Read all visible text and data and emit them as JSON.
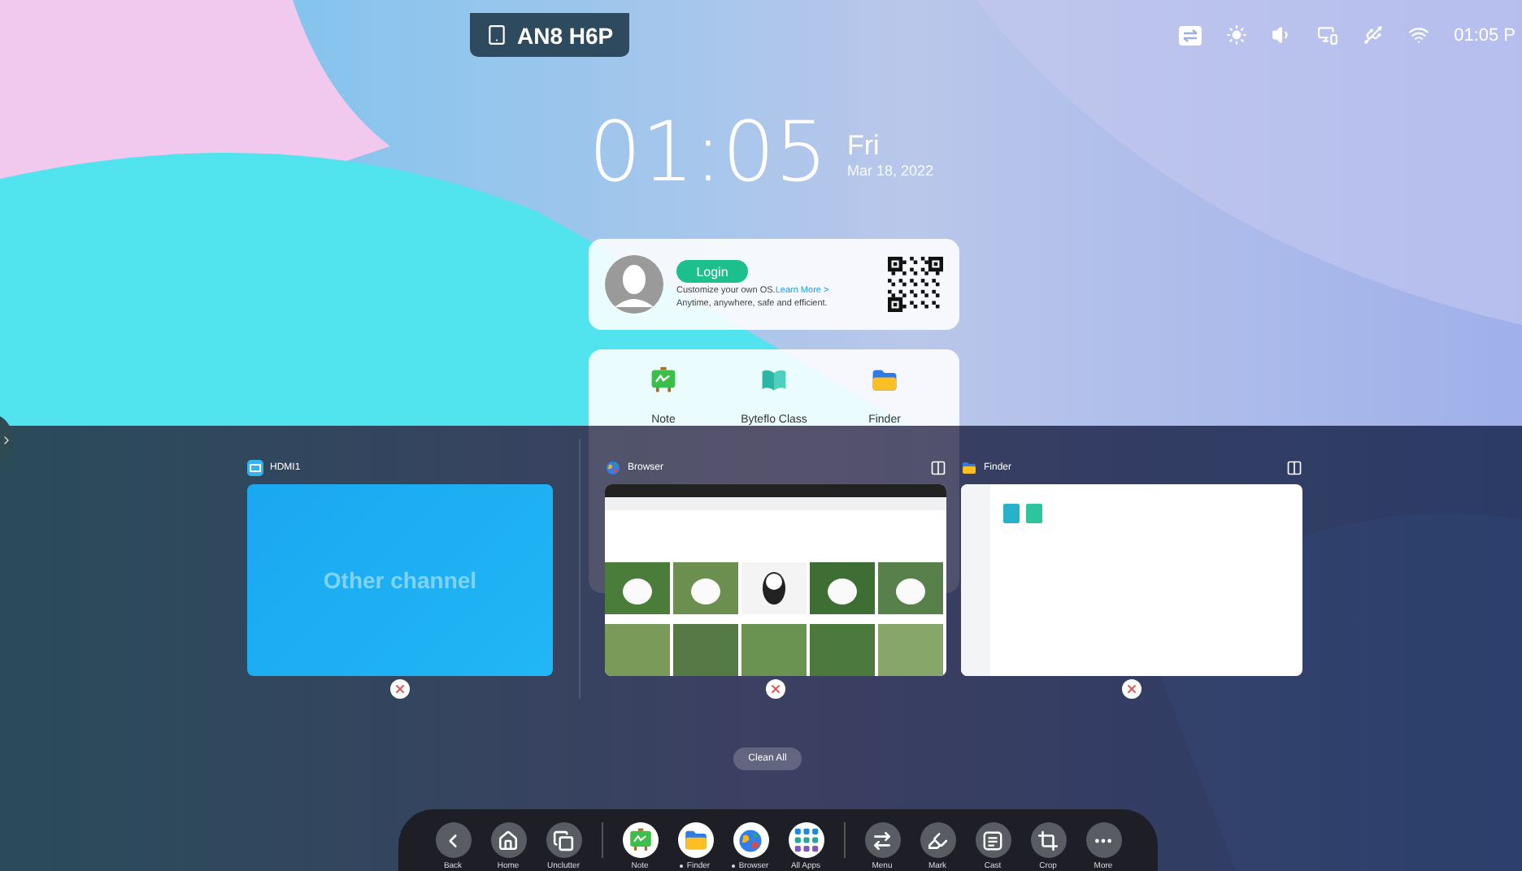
{
  "device_badge": {
    "label": "AN8 H6P"
  },
  "status_bar": {
    "time": "01:05 P"
  },
  "clock": {
    "time": "01:05",
    "weekday": "Fri",
    "date": "Mar 18, 2022"
  },
  "account_card": {
    "button": "Login",
    "line_1": "Customize your own OS.",
    "link": "Learn More >",
    "line_2": "Anytime, anywhere, safe and efficient."
  },
  "quick_apps": [
    {
      "label": "Note",
      "kind": "note"
    },
    {
      "label": "Byteflo Class",
      "kind": "book"
    },
    {
      "label": "Finder",
      "kind": "folder"
    }
  ],
  "recent_tasks": [
    {
      "title": "HDMI1",
      "kind": "source",
      "message": "Other channel",
      "split_screen": false
    },
    {
      "title": "Browser",
      "kind": "browser",
      "split_screen": true
    },
    {
      "title": "Finder",
      "kind": "finder",
      "split_screen": true
    }
  ],
  "clean_all": "Clean All",
  "dock": {
    "groups": [
      [
        {
          "label": "Back",
          "kind": "back",
          "running": false
        },
        {
          "label": "Home",
          "kind": "home",
          "running": false
        },
        {
          "label": "Unclutter",
          "kind": "windows",
          "running": false
        }
      ],
      [
        {
          "label": "Note",
          "kind": "note",
          "running": false
        },
        {
          "label": "Finder",
          "kind": "folder",
          "running": true
        },
        {
          "label": "Browser",
          "kind": "globe",
          "running": true
        },
        {
          "label": "All Apps",
          "kind": "grid",
          "running": false
        }
      ],
      [
        {
          "label": "Menu",
          "kind": "switch",
          "running": false
        },
        {
          "label": "Mark",
          "kind": "marker",
          "running": false
        },
        {
          "label": "Cast",
          "kind": "cast",
          "running": false
        },
        {
          "label": "Crop",
          "kind": "crop",
          "running": false
        },
        {
          "label": "More",
          "kind": "more",
          "running": false
        }
      ]
    ]
  }
}
